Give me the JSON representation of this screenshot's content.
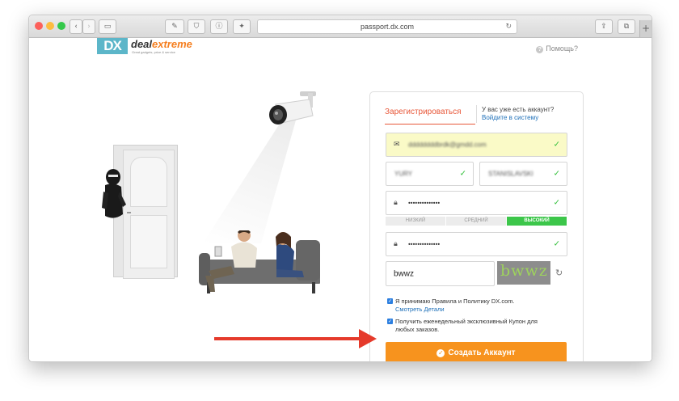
{
  "browser": {
    "url": "passport.dx.com",
    "colors": {
      "close": "#fc605b",
      "minimize": "#fdbc40",
      "zoom": "#34c84a"
    }
  },
  "logo": {
    "mark": "DX",
    "brand_a": "deal",
    "brand_b": "extreme",
    "tagline": "Great gadgets, price & service"
  },
  "header": {
    "help_label": "Помощь?"
  },
  "form": {
    "tab_register": "Зарегистрироваться",
    "have_account": "У вас уже есть аккаунт?",
    "login_link": "Войдите в систему",
    "email_value": "ddddddddbrdk@gmdd.com",
    "first_name_value": "YURY",
    "last_name_value": "STANISLAVSKI",
    "password_value": "••••••••••••••",
    "strength": {
      "low": "НИЗКИЙ",
      "medium": "СРЕДНИЙ",
      "high": "ВЫСОКИЙ"
    },
    "confirm_value": "••••••••••••••",
    "captcha_value": "bwwz",
    "captcha_image_text": "bwwz",
    "agree_text": "Я принимаю Правила и Политику DX.com.",
    "agree_link": "Смотреть Детали",
    "coupon_text": "Получить еженедельный эксклюзивный Купон для любых заказов.",
    "submit_label": "Создать Аккаунт"
  },
  "colors": {
    "accent": "#f7931e",
    "title": "#e8583a",
    "valid": "#36c13e",
    "link": "#1d6fb8",
    "arrow": "#e53a2b"
  }
}
